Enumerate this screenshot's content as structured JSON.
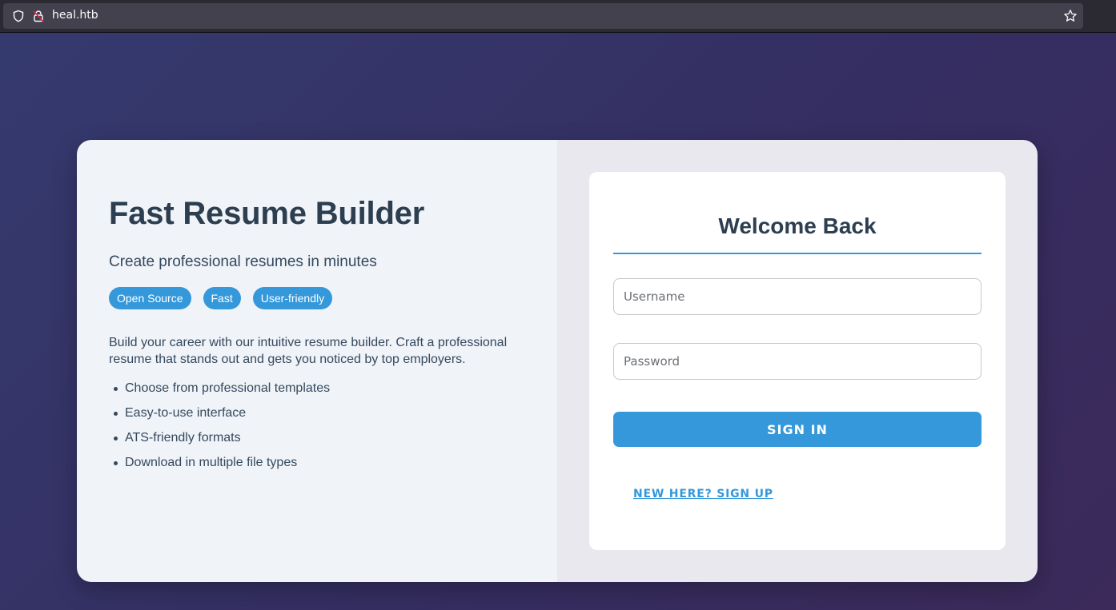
{
  "browser": {
    "url": "heal.htb"
  },
  "hero": {
    "title": "Fast Resume Builder",
    "subtitle": "Create professional resumes in minutes",
    "tags": [
      "Open Source",
      "Fast",
      "User-friendly"
    ],
    "description": "Build your career with our intuitive resume builder. Craft a professional resume that stands out and gets you noticed by top employers.",
    "features": [
      "Choose from professional templates",
      "Easy-to-use interface",
      "ATS-friendly formats",
      "Download in multiple file types"
    ]
  },
  "login": {
    "heading": "Welcome Back",
    "username_placeholder": "Username",
    "username_value": "",
    "password_placeholder": "Password",
    "password_value": "",
    "submit_label": "SIGN IN",
    "signup_link": "NEW HERE? SIGN UP"
  },
  "colors": {
    "accent": "#3498db",
    "heading": "#2c3e50",
    "background_start": "#353a6e",
    "background_end": "#3b2a5a"
  },
  "icons": {
    "shield": "shield-icon",
    "lock": "lock-insecure-icon",
    "bookmark": "star-icon"
  }
}
